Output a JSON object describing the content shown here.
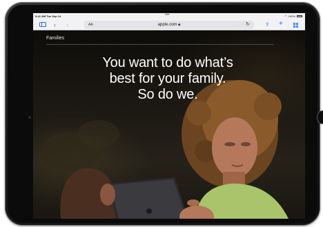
{
  "status_bar": {
    "time": "9:41 AM  Tue Sep 14",
    "dots": "•••",
    "battery_text": "100%"
  },
  "browser": {
    "url": "apple.com",
    "text_size_label": "AA",
    "icons": {
      "sidebar": "sidebar-icon",
      "back": "chevron-left-icon",
      "forward": "chevron-right-icon",
      "reload": "reload-icon",
      "share": "share-icon",
      "new_tab": "plus-icon",
      "tabs": "tabs-grid-icon"
    },
    "accent_color": "#1e6ff0"
  },
  "page": {
    "section_label": "Families",
    "headline": [
      "You want to do what’s",
      "best for your family.",
      "So do we."
    ]
  }
}
